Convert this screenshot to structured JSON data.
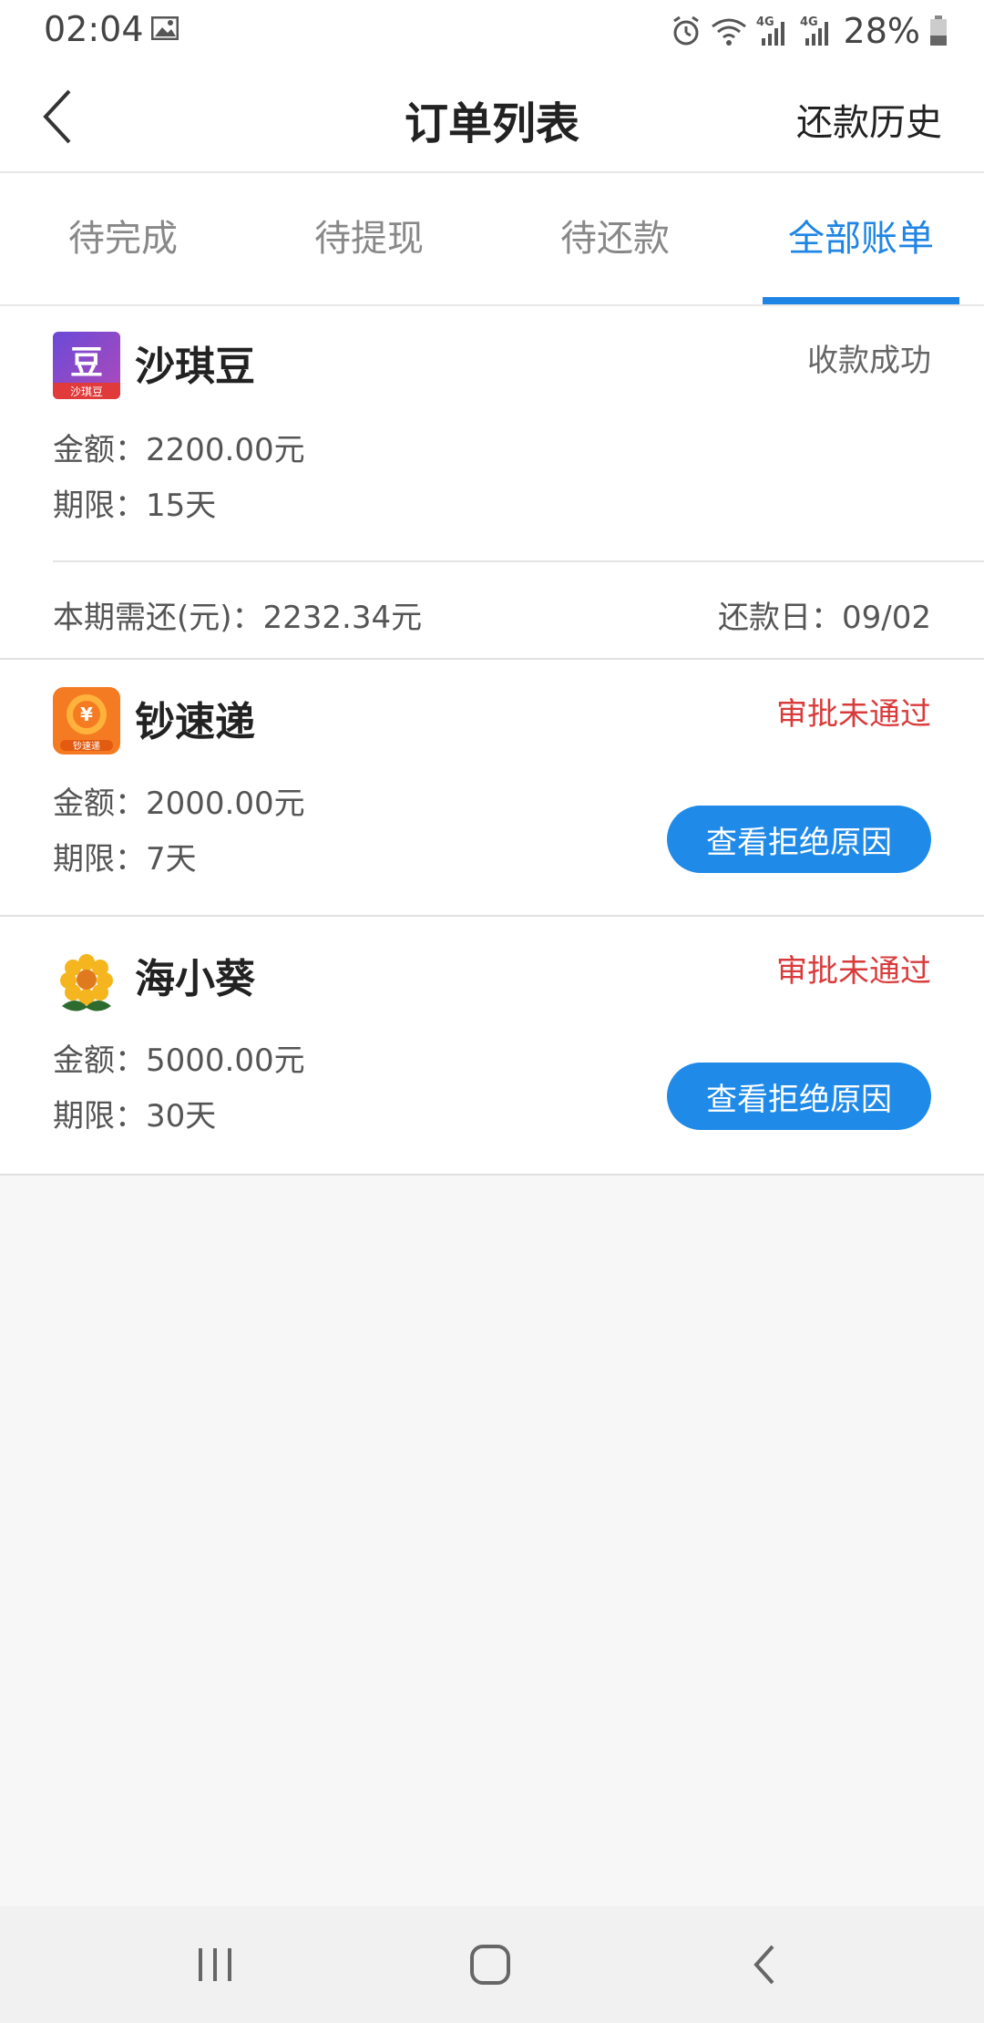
{
  "status_bar": {
    "time": "02:04",
    "network": "4G",
    "battery": "28%"
  },
  "nav": {
    "title": "订单列表",
    "right_label": "还款历史"
  },
  "tabs": [
    {
      "label": "待完成",
      "active": false
    },
    {
      "label": "待提现",
      "active": false
    },
    {
      "label": "待还款",
      "active": false
    },
    {
      "label": "全部账单",
      "active": true
    }
  ],
  "orders": [
    {
      "name": "沙琪豆",
      "logo_text": "沙琪豆",
      "status": "收款成功",
      "amount": "金额：2200.00元",
      "term": "期限：15天",
      "due_amount": "本期需还(元)：2232.34元",
      "due_date": "还款日：09/02"
    },
    {
      "name": "钞速递",
      "logo_text": "钞速递",
      "status": "审批未通过",
      "amount": "金额：2000.00元",
      "term": "期限：7天",
      "button": "查看拒绝原因"
    },
    {
      "name": "海小葵",
      "status": "审批未通过",
      "amount": "金额：5000.00元",
      "term": "期限：30天",
      "button": "查看拒绝原因"
    }
  ],
  "colors": {
    "accent": "#1f85e4",
    "reject": "#d93b3b",
    "button": "#1f8ae8"
  }
}
